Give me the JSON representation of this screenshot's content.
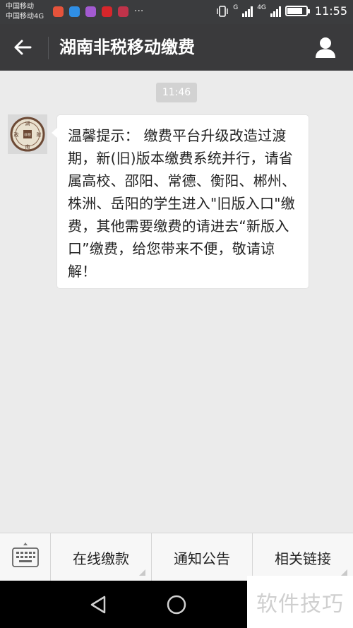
{
  "status_bar": {
    "carrier_1": "中国移动",
    "carrier_2": "中国移动4G",
    "network_1": "G",
    "network_2": "4G",
    "time": "11:55",
    "battery_level": 0.8,
    "icons": [
      "app-icon-red",
      "chat-app-icon",
      "gallery-app-icon",
      "news-app-icon",
      "huawei-app-icon"
    ],
    "more": "···"
  },
  "title_bar": {
    "title": "湖南非税移动缴费",
    "back_icon": "arrow-left-icon",
    "profile_icon": "user-icon"
  },
  "chat": {
    "timestamp": "11:46",
    "message": "温馨提示： 缴费平台升级改造过渡期，新(旧)版本缴费系统并行，请省属高校、邵阳、常德、衡阳、郴州、株洲、岳阳的学生进入\"旧版入口\"缴费，其他需要缴费的请进去“新版入口”缴费，给您带来不便，敬请谅解！",
    "avatar_seal_chars": [
      "湖",
      "財",
      "南",
      "政",
      "非稅"
    ]
  },
  "menu": {
    "keyboard_icon": "keyboard-icon",
    "items": [
      {
        "label": "在线缴款"
      },
      {
        "label": "通知公告"
      },
      {
        "label": "相关链接"
      }
    ]
  },
  "nav_bar": {
    "buttons": [
      "back-triangle-icon",
      "home-circle-icon"
    ]
  },
  "watermark": {
    "text": "软件技巧"
  },
  "colors": {
    "header": "#3a3a3c",
    "background": "#ebebeb",
    "bubble": "#ffffff",
    "timestamp_badge": "#d2d2d2"
  }
}
